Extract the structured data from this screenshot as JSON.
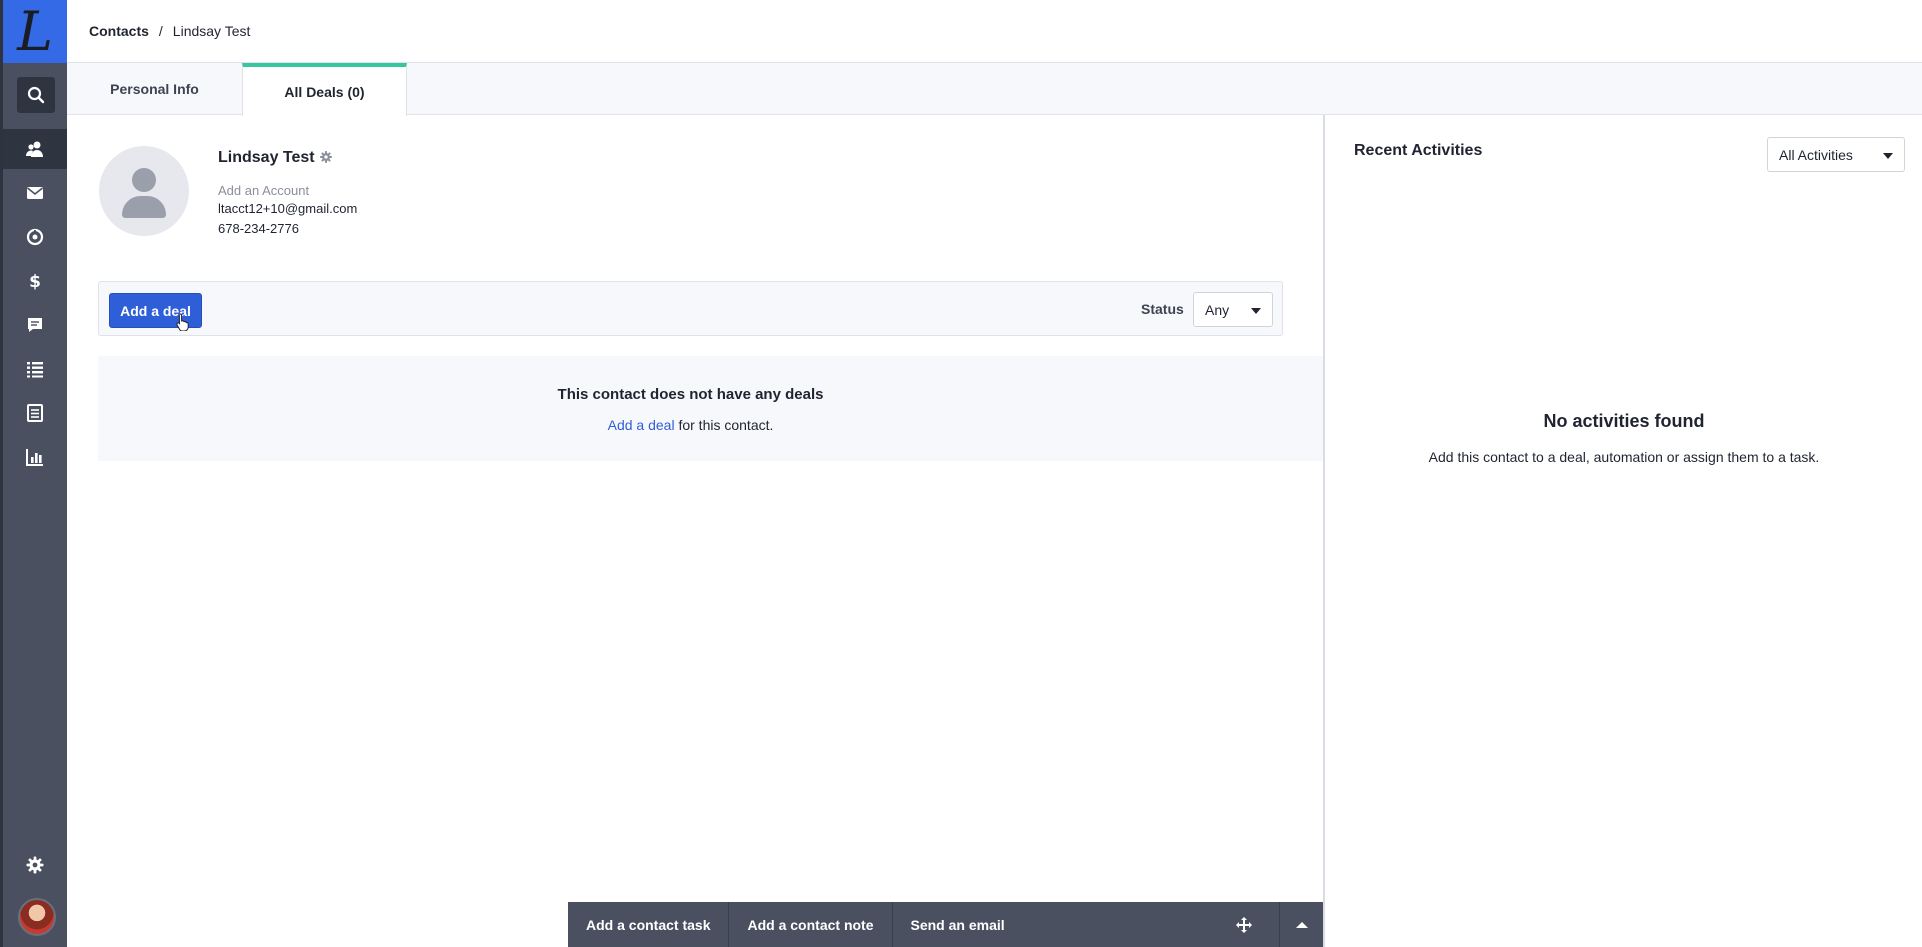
{
  "app": {
    "logo_letter": "L",
    "accent_color": "#356ae6"
  },
  "breadcrumb": {
    "parent": "Contacts",
    "separator": "/",
    "current": "Lindsay Test"
  },
  "tabs": [
    {
      "label": "Personal Info",
      "active": false
    },
    {
      "label": "All Deals (0)",
      "active": true
    }
  ],
  "sidebar": {
    "items": [
      {
        "icon": "search-icon"
      },
      {
        "icon": "contacts-icon"
      },
      {
        "icon": "email-icon"
      },
      {
        "icon": "automations-icon"
      },
      {
        "icon": "dollar-icon"
      },
      {
        "icon": "conversations-icon"
      },
      {
        "icon": "list-icon"
      },
      {
        "icon": "pages-icon"
      },
      {
        "icon": "reports-icon"
      }
    ],
    "bottom": [
      {
        "icon": "gear-icon"
      },
      {
        "icon": "user-avatar"
      }
    ]
  },
  "contact": {
    "name": "Lindsay Test",
    "add_account": "Add an Account",
    "email": "ltacct12+10@gmail.com",
    "phone": "678-234-2776"
  },
  "deals": {
    "add_button": "Add a deal",
    "status_label": "Status",
    "status_value": "Any",
    "empty_title": "This contact does not have any deals",
    "empty_link": "Add a deal",
    "empty_suffix": " for this contact."
  },
  "activities": {
    "title": "Recent Activities",
    "filter_value": "All Activities",
    "empty_title": "No activities found",
    "empty_sub": "Add this contact to a deal, automation or assign them to a task."
  },
  "action_bar": {
    "buttons": [
      "Add a contact task",
      "Add a contact note",
      "Send an email"
    ]
  }
}
